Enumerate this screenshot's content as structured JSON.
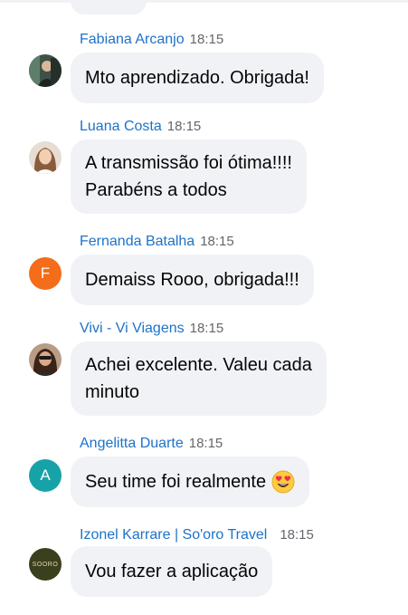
{
  "messages": [
    {
      "name": "Fabiana Arcanjo",
      "time": "18:15",
      "text": [
        "Mto aprendizado. Obrigada!"
      ],
      "avatar": {
        "type": "photo",
        "color": "#2f3b35"
      }
    },
    {
      "name": "Luana Costa",
      "time": "18:15",
      "text": [
        "A transmissão foi ótima!!!!",
        "Parabéns a todos"
      ],
      "avatar": {
        "type": "photo",
        "color": "#c9a383"
      }
    },
    {
      "name": "Fernanda Batalha",
      "time": "18:15",
      "text": [
        "Demaiss Rooo, obrigada!!!"
      ],
      "avatar": {
        "type": "initial",
        "initial": "F",
        "color": "#f36d1a"
      }
    },
    {
      "name": "Vivi - Vi Viagens",
      "time": "18:15",
      "text": [
        "Achei excelente. Valeu cada",
        "minuto"
      ],
      "avatar": {
        "type": "photo",
        "color": "#6b4a3a"
      }
    },
    {
      "name": "Angelitta Duarte",
      "time": "18:15",
      "text": [
        "Seu time foi realmente"
      ],
      "emoji": "heart-eyes-emoji",
      "avatar": {
        "type": "initial",
        "initial": "A",
        "color": "#17a2a8"
      }
    },
    {
      "name": "Izonel Karrare | So'oro Travel",
      "time": "18:15",
      "text": [
        "Vou fazer a aplicação"
      ],
      "avatar": {
        "type": "logo",
        "logo_text": "SOORO",
        "color": "#3a3f1e"
      }
    }
  ]
}
